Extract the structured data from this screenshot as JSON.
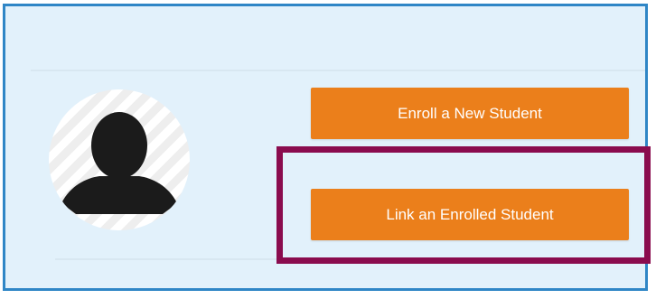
{
  "buttons": {
    "enroll_new": "Enroll a New Student",
    "link_enrolled": "Link an Enrolled Student"
  },
  "colors": {
    "panel_background": "#e2f1fb",
    "panel_border": "#2f86c6",
    "button_background": "#eb7f1b",
    "button_text": "#ffffff",
    "highlight_border": "#8a0c4e"
  },
  "icons": {
    "avatar": "user-silhouette-icon"
  }
}
